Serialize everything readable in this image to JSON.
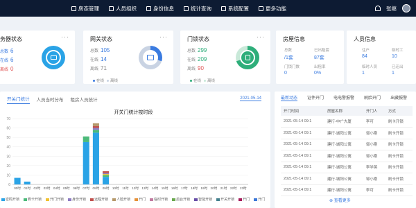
{
  "nav": {
    "items": [
      {
        "label": "房态管理",
        "icon": "house-icon"
      },
      {
        "label": "人员组织",
        "icon": "people-icon"
      },
      {
        "label": "身份信息",
        "icon": "id-card-icon"
      },
      {
        "label": "统计查询",
        "icon": "chart-icon"
      },
      {
        "label": "系统配置",
        "icon": "settings-icon"
      },
      {
        "label": "更多功能",
        "icon": "more-icon"
      }
    ],
    "user_name": "张继"
  },
  "cards": {
    "service": {
      "title": "务器状态",
      "rows": [
        {
          "label": "总数",
          "value": "6"
        },
        {
          "label": "在线",
          "value": "6"
        },
        {
          "label": "离线",
          "value": "0"
        }
      ]
    },
    "gateway": {
      "title": "网关状态",
      "rows": [
        {
          "label": "总数",
          "value": "105"
        },
        {
          "label": "在线",
          "value": "14"
        },
        {
          "label": "离线",
          "value": "71"
        }
      ],
      "legend": [
        "在线",
        "离线"
      ]
    },
    "lock": {
      "title": "门锁状态",
      "rows": [
        {
          "label": "总数",
          "value": "299"
        },
        {
          "label": "在线",
          "value": "209"
        },
        {
          "label": "离线",
          "value": "90"
        }
      ],
      "legend": [
        "在线",
        "离线"
      ]
    },
    "house": {
      "title": "房屋信息",
      "cells": [
        {
          "label": "总数",
          "value": "/1套"
        },
        {
          "label": "已出租套",
          "value": "87套"
        },
        {
          "label": "门锁门数",
          "value": "0"
        },
        {
          "label": "出租率",
          "value": "0%"
        }
      ]
    },
    "people": {
      "title": "人员信息",
      "cells": [
        {
          "label": "住户",
          "value": "84"
        },
        {
          "label": "临时工",
          "value": "10"
        },
        {
          "label": "临时人员",
          "value": "1"
        },
        {
          "label": "已迁出",
          "value": "1"
        }
      ]
    }
  },
  "tabs": [
    "开关门统计",
    "人员当时分布",
    "租房人员统计"
  ],
  "date": "2021-05-14",
  "right_tabs": [
    "最新动态",
    "证件开门",
    "电电警报警",
    "刷脸开门",
    "出藏报警"
  ],
  "table": {
    "headers": [
      "开门时间",
      "房屋名称",
      "开门人",
      "方式"
    ],
    "rows": [
      [
        "2021-05-14 09:1",
        "建行-中广大厦",
        "李可",
        "刷卡开锁"
      ],
      [
        "2021-05-14 09:1",
        "建行-城阳公寓",
        "邹小刚",
        "刷卡开锁"
      ],
      [
        "2021-05-14 09:1",
        "建行-城阳公寓",
        "邹小刚",
        "刷卡开锁"
      ],
      [
        "2021-05-14 09:1",
        "建行-城阳公寓",
        "邹小刚",
        "刷卡开锁"
      ],
      [
        "2021-05-14 09:1",
        "建行-城阳公寓",
        "李学英",
        "刷卡开锁"
      ],
      [
        "2021-05-14 09:1",
        "建行-城阳公寓",
        "邹小刚",
        "刷卡开锁"
      ],
      [
        "2021-05-14 09:1",
        "建行-城阳公寓",
        "李可",
        "刷卡开锁"
      ]
    ],
    "more": "查看更多"
  },
  "chart_data": {
    "type": "bar",
    "title": "开关门统计按时段",
    "categories": [
      "00时",
      "01时",
      "02时",
      "03时",
      "04时",
      "05时",
      "06时",
      "07时",
      "08时",
      "09时",
      "10时",
      "11时",
      "12时",
      "13时",
      "14时",
      "15时",
      "16时",
      "17时",
      "18时",
      "19时",
      "20时",
      "21时",
      "22时",
      "23时"
    ],
    "series": [
      {
        "name": "密码开锁",
        "color": "#2aa3e6",
        "values": [
          7,
          3,
          0,
          0,
          0,
          0,
          0,
          45,
          55,
          8,
          0,
          0,
          0,
          0,
          0,
          0,
          0,
          0,
          0,
          0,
          0,
          0,
          0,
          0
        ]
      },
      {
        "name": "刷卡开锁",
        "color": "#4cba7a",
        "values": [
          0,
          0,
          0,
          0,
          0,
          0,
          0,
          6,
          3,
          2,
          0,
          0,
          0,
          0,
          0,
          0,
          0,
          0,
          0,
          0,
          0,
          0,
          0,
          0
        ]
      },
      {
        "name": "开门开锁",
        "color": "#f1c232",
        "values": [
          0,
          0,
          0,
          0,
          0,
          0,
          0,
          0,
          0,
          1,
          0,
          0,
          0,
          0,
          0,
          0,
          0,
          0,
          0,
          0,
          0,
          0,
          0,
          0
        ]
      },
      {
        "name": "身份开锁",
        "color": "#8e7cc3",
        "values": [
          0,
          0,
          0,
          0,
          0,
          0,
          0,
          0,
          2,
          1,
          0,
          0,
          0,
          0,
          0,
          0,
          0,
          0,
          0,
          0,
          0,
          0,
          0,
          0
        ]
      },
      {
        "name": "远程开锁",
        "color": "#c0504d",
        "values": [
          0,
          0,
          0,
          0,
          0,
          0,
          0,
          0,
          2,
          2,
          0,
          0,
          0,
          0,
          0,
          0,
          0,
          0,
          0,
          0,
          0,
          0,
          0,
          0
        ]
      },
      {
        "name": "人脸开锁",
        "color": "#b5986a",
        "values": [
          0,
          0,
          0,
          0,
          0,
          0,
          0,
          0,
          3,
          0,
          0,
          0,
          0,
          0,
          0,
          0,
          0,
          0,
          0,
          0,
          0,
          0,
          0,
          0
        ]
      },
      {
        "name": "开门",
        "color": "#e69138",
        "values": [
          0,
          0,
          0,
          0,
          0,
          0,
          0,
          0,
          0,
          0,
          0,
          0,
          0,
          0,
          0,
          0,
          0,
          0,
          0,
          0,
          0,
          0,
          0,
          0
        ]
      },
      {
        "name": "临时开锁",
        "color": "#c27ba0",
        "values": [
          0,
          0,
          0,
          0,
          0,
          0,
          0,
          0,
          0,
          0,
          0,
          0,
          0,
          0,
          0,
          0,
          0,
          0,
          0,
          0,
          0,
          0,
          0,
          0
        ]
      },
      {
        "name": "后台开锁",
        "color": "#6aa84f",
        "values": [
          0,
          0,
          0,
          0,
          0,
          0,
          0,
          0,
          0,
          0,
          0,
          0,
          0,
          0,
          0,
          0,
          0,
          0,
          0,
          0,
          0,
          0,
          0,
          0
        ]
      },
      {
        "name": "智能开锁",
        "color": "#674ea7",
        "values": [
          0,
          0,
          0,
          0,
          0,
          0,
          0,
          0,
          0,
          0,
          0,
          0,
          0,
          0,
          0,
          0,
          0,
          0,
          0,
          0,
          0,
          0,
          0,
          0
        ]
      },
      {
        "name": "开关开锁",
        "color": "#45818e",
        "values": [
          0,
          0,
          0,
          0,
          0,
          0,
          0,
          0,
          0,
          0,
          0,
          0,
          0,
          0,
          0,
          0,
          0,
          0,
          0,
          0,
          0,
          0,
          0,
          0
        ]
      },
      {
        "name": "开门",
        "color": "#a61c5b",
        "values": [
          0,
          0,
          0,
          0,
          0,
          0,
          0,
          0,
          0,
          0,
          0,
          0,
          0,
          0,
          0,
          0,
          0,
          0,
          0,
          0,
          0,
          0,
          0,
          0
        ]
      },
      {
        "name": "开门",
        "color": "#3c78d8",
        "values": [
          0,
          0,
          0,
          0,
          0,
          0,
          0,
          0,
          0,
          0,
          0,
          0,
          0,
          0,
          0,
          0,
          0,
          0,
          0,
          0,
          0,
          0,
          0,
          0
        ]
      }
    ],
    "ylim": [
      0,
      70
    ],
    "yticks": [
      0,
      10,
      20,
      30,
      40,
      50,
      60,
      70
    ],
    "xlabel": "",
    "ylabel": "",
    "stacked": true,
    "legend_position": "bottom"
  }
}
